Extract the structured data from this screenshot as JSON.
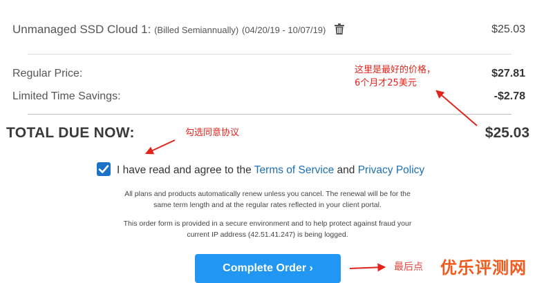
{
  "line_item": {
    "name": "Unmanaged SSD Cloud 1:",
    "billing": "(Billed Semiannually)",
    "dates": "(04/20/19 - 10/07/19)",
    "price": "$25.03"
  },
  "regular_price": {
    "label": "Regular Price:",
    "value": "$27.81"
  },
  "savings": {
    "label": "Limited Time Savings:",
    "value": "-$2.78"
  },
  "total": {
    "label": "TOTAL DUE NOW:",
    "value": "$25.03"
  },
  "agreement": {
    "prefix": "I have read and agree to the",
    "tos": "Terms of Service",
    "and": "and",
    "privacy": "Privacy Policy",
    "checked": true
  },
  "notice1": {
    "line1": "All plans and products automatically renew unless you cancel. The renewal will be for the",
    "line2": "same term length and at the regular rates reflected in your client portal."
  },
  "notice2": {
    "line1": "This order form is provided in a secure environment and to help protect against fraud your",
    "line2": "current IP address (42.51.41.247) is being logged."
  },
  "complete_button": {
    "label": "Complete Order ›",
    "color": "#2196f3"
  },
  "annotations": {
    "best_price_line1": "这里是最好的价格，",
    "best_price_line2": "6个月才25美元",
    "check_agree": "勾选同意协议",
    "last_step": "最后点"
  },
  "watermark": "优乐评测网",
  "icons": [
    "trash-icon",
    "check-icon"
  ]
}
